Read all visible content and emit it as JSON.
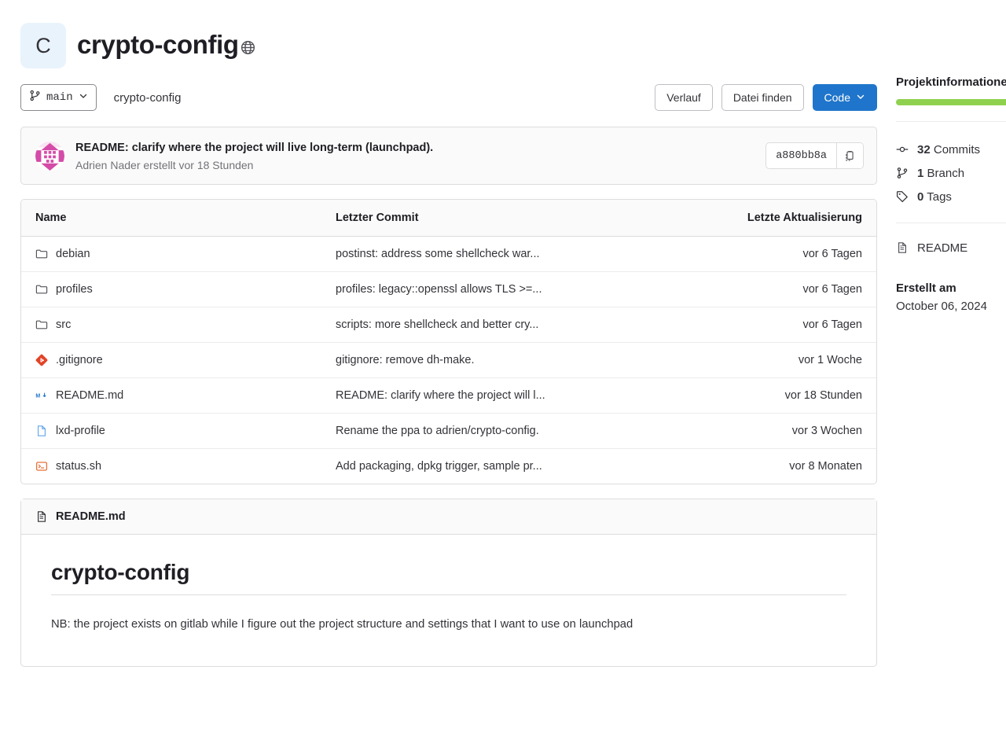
{
  "project": {
    "avatar_letter": "C",
    "name": "crypto-config",
    "visibility_icon": "globe-icon"
  },
  "toolbar": {
    "branch": "main",
    "breadcrumb": "crypto-config",
    "history_label": "Verlauf",
    "find_file_label": "Datei finden",
    "code_label": "Code"
  },
  "last_commit": {
    "title": "README: clarify where the project will live long-term (launchpad).",
    "meta": "Adrien Nader erstellt vor 18 Stunden",
    "sha": "a880bb8a",
    "copy_icon": "clipboard-icon"
  },
  "tree": {
    "headers": {
      "name": "Name",
      "commit": "Letzter Commit",
      "updated": "Letzte Aktualisierung"
    },
    "rows": [
      {
        "icon": "folder-icon",
        "name": "debian",
        "commit": "postinst: address some shellcheck war...",
        "updated": "vor 6 Tagen"
      },
      {
        "icon": "folder-icon",
        "name": "profiles",
        "commit": "profiles: legacy::openssl allows TLS >=...",
        "updated": "vor 6 Tagen"
      },
      {
        "icon": "folder-icon",
        "name": "src",
        "commit": "scripts: more shellcheck and better cry...",
        "updated": "vor 6 Tagen"
      },
      {
        "icon": "git-icon",
        "name": ".gitignore",
        "commit": "gitignore: remove dh-make.",
        "updated": "vor 1 Woche"
      },
      {
        "icon": "markdown-icon",
        "name": "README.md",
        "commit": "README: clarify where the project will l...",
        "updated": "vor 18 Stunden"
      },
      {
        "icon": "file-icon",
        "name": "lxd-profile",
        "commit": "Rename the ppa to adrien/crypto-config.",
        "updated": "vor 3 Wochen"
      },
      {
        "icon": "shell-icon",
        "name": "status.sh",
        "commit": "Add packaging, dpkg trigger, sample pr...",
        "updated": "vor 8 Monaten"
      }
    ]
  },
  "readme": {
    "filename": "README.md",
    "heading": "crypto-config",
    "paragraph": "NB: the project exists on gitlab while I figure out the project structure and settings that I want to use on launchpad"
  },
  "sidebar": {
    "title": "Projektinformationen",
    "language_color": "#8fd14f",
    "stats": [
      {
        "icon": "commit-icon",
        "count": "32",
        "label": "Commits"
      },
      {
        "icon": "branch-icon",
        "count": "1",
        "label": "Branch"
      },
      {
        "icon": "tag-icon",
        "count": "0",
        "label": "Tags"
      }
    ],
    "links": [
      {
        "icon": "document-icon",
        "label": "README"
      }
    ],
    "created_label": "Erstellt am",
    "created_value": "October 06, 2024"
  }
}
